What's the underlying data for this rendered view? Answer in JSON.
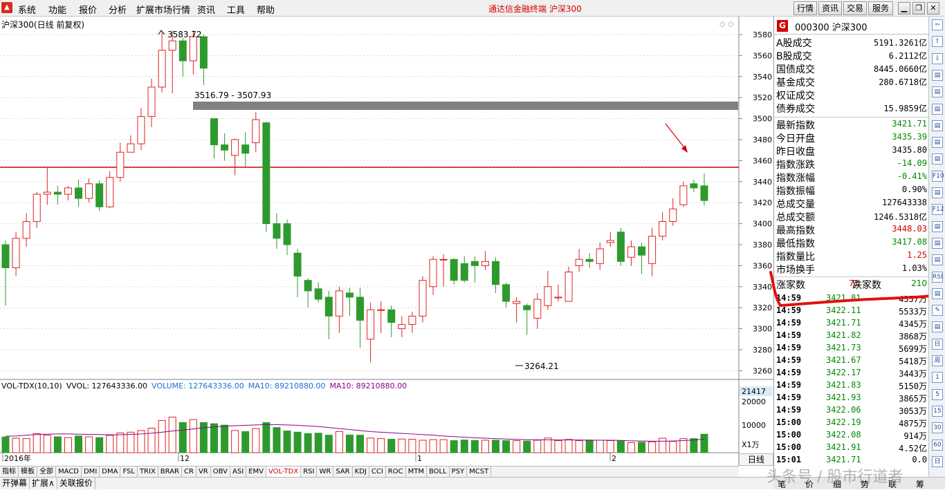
{
  "menubar": {
    "items": [
      "系统",
      "功能",
      "报价",
      "分析",
      "扩展市场行情",
      "资讯",
      "工具",
      "帮助"
    ],
    "app_title": "通达信金融终端 沪深300",
    "right_buttons": [
      "行情",
      "资讯",
      "交易",
      "服务"
    ]
  },
  "chart": {
    "title": "沪深300(日线 前复权)",
    "high_label": "3583.72",
    "low_label": "3264.21",
    "zone_label": "3516.79 - 3507.93",
    "x_labels": [
      "2016年",
      "12",
      "1",
      "2"
    ],
    "price_ticks": [
      "3580",
      "3560",
      "3540",
      "3520",
      "3500",
      "3480",
      "3460",
      "3440",
      "3420",
      "3400",
      "3380",
      "3360",
      "3340",
      "3320",
      "3300",
      "3280",
      "3260"
    ],
    "vol_ticks": [
      "21417",
      "20000",
      "10000",
      "X1万"
    ],
    "colors": {
      "up": "#e02020",
      "down": "#2e9a2e",
      "ma": "#8b008b",
      "zone": "#808080",
      "resistance": "#cc0000"
    }
  },
  "vol_info": {
    "name": "VOL-TDX(10,10)",
    "vvol": "VVOL: 127643336.00",
    "volume": "VOLUME: 127643336.00",
    "ma1": "MA10: 89210880.00",
    "ma2": "MA10: 89210880.00"
  },
  "chart_data": {
    "type": "candlestick",
    "ylim": [
      3255,
      3590
    ],
    "candles": [
      [
        3380,
        3358,
        3384,
        3322
      ],
      [
        3358,
        3386,
        3392,
        3350
      ],
      [
        3386,
        3402,
        3410,
        3378
      ],
      [
        3402,
        3428,
        3430,
        3396
      ],
      [
        3428,
        3430,
        3454,
        3418
      ],
      [
        3430,
        3428,
        3436,
        3418
      ],
      [
        3428,
        3434,
        3436,
        3422
      ],
      [
        3434,
        3424,
        3442,
        3416
      ],
      [
        3424,
        3438,
        3443,
        3420
      ],
      [
        3438,
        3416,
        3441,
        3412
      ],
      [
        3416,
        3444,
        3450,
        3415
      ],
      [
        3444,
        3468,
        3477,
        3440
      ],
      [
        3468,
        3476,
        3484,
        3468
      ],
      [
        3476,
        3502,
        3510,
        3470
      ],
      [
        3502,
        3530,
        3538,
        3492
      ],
      [
        3530,
        3565,
        3582,
        3525
      ],
      [
        3565,
        3574,
        3584,
        3524
      ],
      [
        3574,
        3555,
        3577,
        3540
      ],
      [
        3555,
        3578,
        3584,
        3542
      ],
      [
        3578,
        3548,
        3580,
        3532
      ],
      [
        3500,
        3475,
        3496,
        3462
      ],
      [
        3475,
        3470,
        3486,
        3460
      ],
      [
        3465,
        3480,
        3481,
        3446
      ],
      [
        3475,
        3467,
        3487,
        3453
      ],
      [
        3477,
        3499,
        3506,
        3468
      ],
      [
        3496,
        3400,
        3497,
        3392
      ],
      [
        3400,
        3386,
        3410,
        3376
      ],
      [
        3400,
        3380,
        3404,
        3370
      ],
      [
        3372,
        3350,
        3376,
        3330
      ],
      [
        3346,
        3336,
        3348,
        3320
      ],
      [
        3338,
        3328,
        3344,
        3325
      ],
      [
        3330,
        3312,
        3336,
        3290
      ],
      [
        3312,
        3336,
        3340,
        3296
      ],
      [
        3334,
        3330,
        3339,
        3312
      ],
      [
        3330,
        3308,
        3339,
        3282
      ],
      [
        3290,
        3318,
        3325,
        3268
      ],
      [
        3318,
        3318,
        3326,
        3296
      ],
      [
        3318,
        3306,
        3322,
        3292
      ],
      [
        3300,
        3304,
        3312,
        3292
      ],
      [
        3304,
        3312,
        3316,
        3296
      ],
      [
        3312,
        3346,
        3350,
        3306
      ],
      [
        3340,
        3366,
        3369,
        3332
      ],
      [
        3366,
        3366,
        3371,
        3340
      ],
      [
        3366,
        3346,
        3367,
        3342
      ],
      [
        3362,
        3346,
        3369,
        3344
      ],
      [
        3364,
        3360,
        3369,
        3344
      ],
      [
        3360,
        3364,
        3374,
        3356
      ],
      [
        3364,
        3342,
        3368,
        3334
      ],
      [
        3342,
        3326,
        3344,
        3320
      ],
      [
        3324,
        3326,
        3330,
        3306
      ],
      [
        3322,
        3318,
        3324,
        3294
      ],
      [
        3310,
        3328,
        3334,
        3300
      ],
      [
        3322,
        3340,
        3355,
        3318
      ],
      [
        3330,
        3330,
        3342,
        3326
      ],
      [
        3326,
        3354,
        3359,
        3330
      ],
      [
        3360,
        3366,
        3376,
        3354
      ],
      [
        3366,
        3364,
        3372,
        3358
      ],
      [
        3362,
        3376,
        3382,
        3356
      ],
      [
        3382,
        3384,
        3392,
        3378
      ],
      [
        3392,
        3364,
        3396,
        3360
      ],
      [
        3368,
        3378,
        3384,
        3360
      ],
      [
        3378,
        3370,
        3382,
        3352
      ],
      [
        3362,
        3388,
        3396,
        3350
      ],
      [
        3388,
        3402,
        3411,
        3384
      ],
      [
        3402,
        3414,
        3424,
        3398
      ],
      [
        3418,
        3436,
        3440,
        3416
      ],
      [
        3438,
        3434,
        3442,
        3430
      ],
      [
        3436,
        3422,
        3448,
        3417
      ]
    ],
    "volumes_wan": [
      7800,
      7200,
      7000,
      9500,
      8700,
      7900,
      7500,
      8300,
      7900,
      7500,
      8600,
      9800,
      10200,
      11000,
      12200,
      16000,
      17700,
      15000,
      16500,
      15000,
      14400,
      13700,
      11000,
      10500,
      12000,
      15000,
      12500,
      10800,
      10200,
      9500,
      9700,
      8700,
      10500,
      8800,
      8700,
      7300,
      7000,
      6700,
      6800,
      6700,
      6200,
      6500,
      6500,
      6000,
      6300,
      6100,
      6200,
      6200,
      6000,
      6000,
      5800,
      6200,
      7300,
      6000,
      6600,
      6000,
      6300,
      6200,
      6000,
      5800,
      5000,
      5200,
      5400,
      7200,
      5600,
      7000,
      7000,
      9200
    ],
    "vol_ma10_wan": [
      8200,
      8300,
      8700,
      9000,
      9200,
      9300,
      9300,
      9200,
      9100,
      9000,
      8900,
      8900,
      9100,
      9300,
      9700,
      10200,
      10800,
      11200,
      11800,
      12400,
      12800,
      13200,
      13400,
      13600,
      13800,
      14000,
      13900,
      13800,
      13600,
      13300,
      13000,
      12500,
      12000,
      11500,
      11000,
      10500,
      10200,
      9900,
      9600,
      9300,
      9000,
      8700,
      8300,
      8000,
      7700,
      7400,
      7200,
      7000,
      6800,
      6600,
      6500,
      6400,
      6400,
      6300,
      6300,
      6300,
      6200,
      6200,
      6200,
      6100,
      5900,
      5800,
      5700,
      5700,
      5800,
      6000,
      6300,
      6700
    ]
  },
  "right_panel": {
    "g_label": "G",
    "code_name": "000300 沪深300",
    "turnover_rows": [
      {
        "label": "A股成交",
        "value": "5191.3261亿"
      },
      {
        "label": "B股成交",
        "value": "6.2112亿"
      },
      {
        "label": "国债成交",
        "value": "8445.0660亿"
      },
      {
        "label": "基金成交",
        "value": "280.6718亿"
      },
      {
        "label": "权证成交",
        "value": ""
      },
      {
        "label": "债券成交",
        "value": "15.9859亿"
      }
    ],
    "quote_rows": [
      {
        "label": "最新指数",
        "value": "3421.71",
        "color": "#008800"
      },
      {
        "label": "今日开盘",
        "value": "3435.39",
        "color": "#008800"
      },
      {
        "label": "昨日收盘",
        "value": "3435.80",
        "color": "#000000"
      },
      {
        "label": "指数涨跌",
        "value": "-14.09",
        "color": "#008800"
      },
      {
        "label": "指数涨幅",
        "value": "-0.41%",
        "color": "#008800"
      },
      {
        "label": "指数振幅",
        "value": "0.90%",
        "color": "#000000"
      },
      {
        "label": "总成交量",
        "value": "127643338",
        "color": "#000000"
      },
      {
        "label": "总成交额",
        "value": "1246.5318亿",
        "color": "#000000"
      },
      {
        "label": "最高指数",
        "value": "3448.03",
        "color": "#d40000"
      },
      {
        "label": "最低指数",
        "value": "3417.08",
        "color": "#008800"
      },
      {
        "label": "指数量比",
        "value": "1.25",
        "color": "#d40000"
      },
      {
        "label": "市场换手",
        "value": "1.03%",
        "color": "#000000"
      }
    ],
    "breadth": {
      "up_label": "涨家数",
      "up_value": "71",
      "down_label": "跌家数",
      "down_value": "210"
    },
    "ticks": [
      {
        "time": "14:59",
        "price": "3421.81",
        "vol": "4357万"
      },
      {
        "time": "14:59",
        "price": "3422.11",
        "vol": "5533万"
      },
      {
        "time": "14:59",
        "price": "3421.71",
        "vol": "4345万"
      },
      {
        "time": "14:59",
        "price": "3421.82",
        "vol": "3868万"
      },
      {
        "time": "14:59",
        "price": "3421.73",
        "vol": "5699万"
      },
      {
        "time": "14:59",
        "price": "3421.67",
        "vol": "5418万"
      },
      {
        "time": "14:59",
        "price": "3422.17",
        "vol": "3443万"
      },
      {
        "time": "14:59",
        "price": "3421.83",
        "vol": "5150万"
      },
      {
        "time": "14:59",
        "price": "3421.93",
        "vol": "3865万"
      },
      {
        "time": "14:59",
        "price": "3422.06",
        "vol": "3053万"
      },
      {
        "time": "15:00",
        "price": "3422.19",
        "vol": "4875万"
      },
      {
        "time": "15:00",
        "price": "3422.08",
        "vol": "914万"
      },
      {
        "time": "15:00",
        "price": "3421.91",
        "vol": "4.52亿"
      },
      {
        "time": "15:01",
        "price": "3421.71",
        "vol": "0.0"
      }
    ]
  },
  "indicator_tabs": [
    "指标",
    "模板",
    "全部",
    "MACD",
    "DMI",
    "DMA",
    "FSL",
    "TRIX",
    "BRAR",
    "CR",
    "VR",
    "OBV",
    "ASI",
    "EMV",
    "VOL-TDX",
    "RSI",
    "WR",
    "SAR",
    "KDJ",
    "CCI",
    "ROC",
    "MTM",
    "BOLL",
    "PSY",
    "MCST"
  ],
  "bottom_tabs": [
    "开弹幕",
    "扩展∧",
    "关联报价"
  ],
  "period": "日线",
  "right_bottom_tabs": [
    "笔",
    "价",
    "细",
    "势",
    "联",
    "筹"
  ],
  "watermark": "头条号 / 股市行道者",
  "side_icons": [
    "⇦",
    "⇧",
    "⇩",
    "▤",
    "▤",
    "▤",
    "▤",
    "▤",
    "▤",
    "F10",
    "▤",
    "F12",
    "▤",
    "▤",
    "▤",
    "RSI",
    "▤",
    "✎",
    "▤",
    "日",
    "周",
    "1",
    "5",
    "15",
    "30",
    "60",
    "日"
  ]
}
